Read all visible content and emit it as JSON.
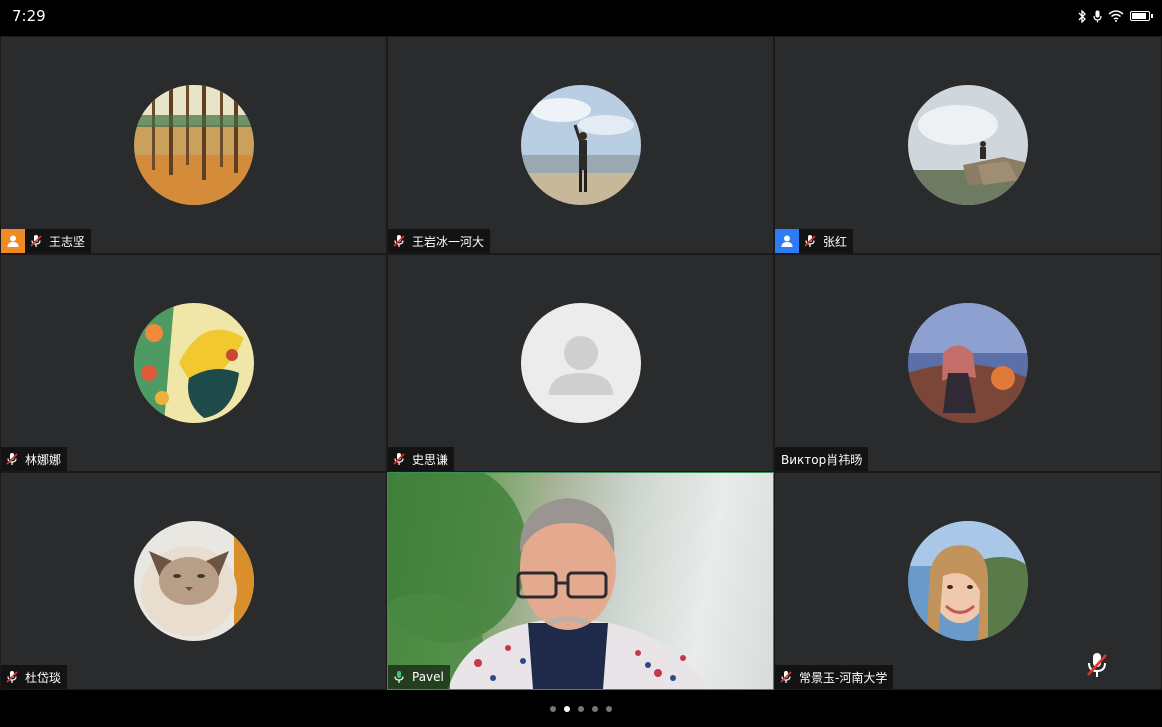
{
  "status": {
    "time": "7:29"
  },
  "participants": [
    {
      "name": "王志坚",
      "role": "host",
      "muted": true
    },
    {
      "name": "王岩冰一河大",
      "role": "none",
      "muted": true
    },
    {
      "name": "张红",
      "role": "cohost",
      "muted": true
    },
    {
      "name": "林娜娜",
      "role": "none",
      "muted": true
    },
    {
      "name": "史思谦",
      "role": "none",
      "muted": true
    },
    {
      "name": "Виктор肖祎旸",
      "role": "none",
      "muted": null
    },
    {
      "name": "杜岱琰",
      "role": "none",
      "muted": true
    },
    {
      "name": "Pavel",
      "role": "none",
      "muted": false,
      "video_on": true
    },
    {
      "name": "常景玉-河南大学",
      "role": "none",
      "muted": true
    }
  ],
  "pager": {
    "pages": 5,
    "current": 2
  },
  "colors": {
    "host_badge": "#f08a24",
    "cohost_badge": "#2d7cf6",
    "tile_bg": "#2a2b2d",
    "active_border": "#3a8f55"
  }
}
